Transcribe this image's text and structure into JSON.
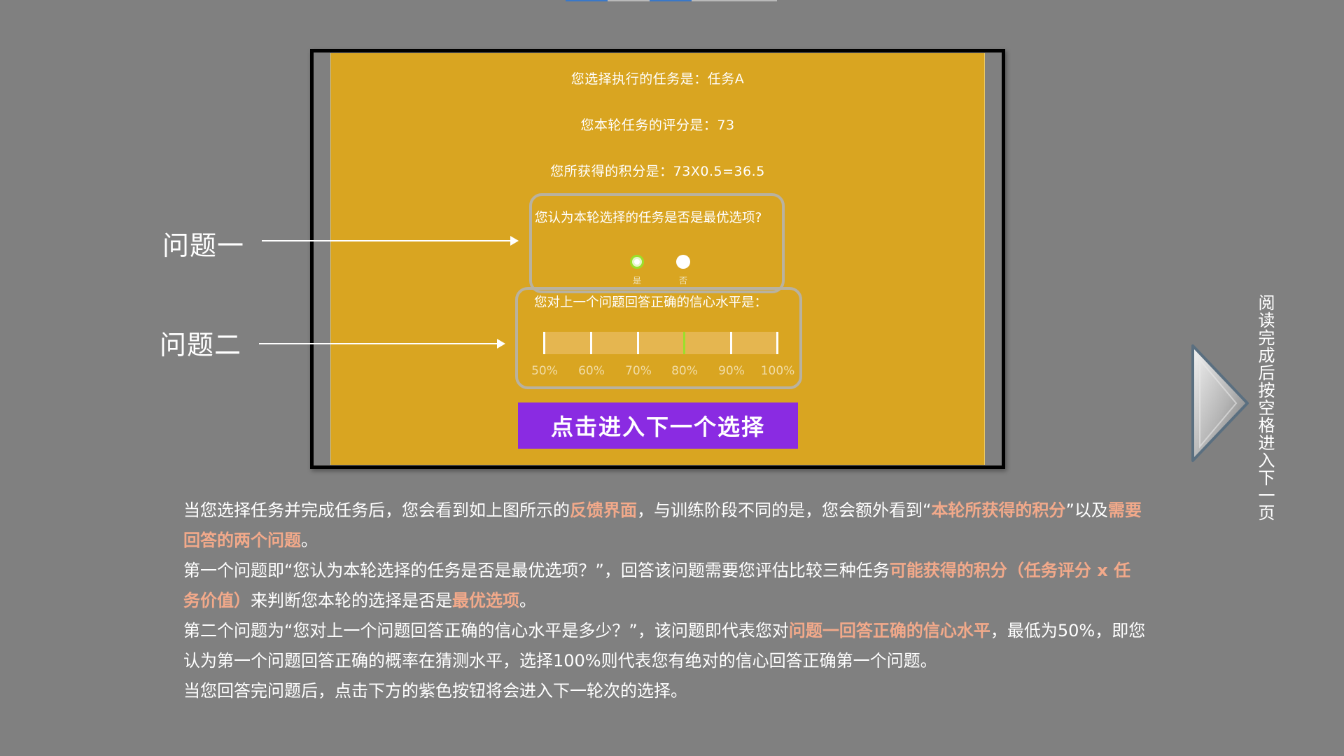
{
  "screenshot": {
    "task_line": "您选择执行的任务是：任务A",
    "score_line": "您本轮任务的评分是：73",
    "points_line": "您所获得的积分是：73X0.5=36.5",
    "question1": {
      "text": "您认为本轮选择的任务是否是最优选项?",
      "options": [
        "是",
        "否"
      ],
      "selected": "是"
    },
    "question2": {
      "text": "您对上一个问题回答正确的信心水平是：",
      "ticks": [
        "50%",
        "60%",
        "70%",
        "80%",
        "90%",
        "100%"
      ],
      "selected": "80%"
    },
    "next_button": "点击进入下一个选择"
  },
  "callouts": {
    "q1": "问题一",
    "q2": "问题二"
  },
  "description": {
    "p1": {
      "t1": "当您选择任务并完成任务后，您会看到如上图所示的",
      "h1": "反馈界面",
      "t2": "，与训练阶段不同的是，您会额外看到“",
      "h2": "本轮所获得的积分",
      "t3": "”以及",
      "h3": "需要回答的两个问题",
      "t4": "。"
    },
    "p2": {
      "t1": "第一个问题即“您认为本轮选择的任务是否是最优选项？”，回答该问题需要您评估比较三种任务",
      "h1": "可能获得的积分（任务评分 x 任务价值）",
      "t2": "来判断您本轮的选择是否是",
      "h2": "最优选项",
      "t3": "。"
    },
    "p3": {
      "t1": "第二个问题为“您对上一个问题回答正确的信心水平是多少？”，该问题即代表您对",
      "h1": "问题一回答正确的信心水平",
      "t2": "，最低为50%，即您认为第一个问题回答正确的概率在猜测水平，选择100%则代表您有绝对的信心回答正确第一个问题。"
    },
    "p4": "当您回答完问题后，点击下方的紫色按钮将会进入下一轮次的选择。"
  },
  "side_note": "阅读完成后按空格进入下一页",
  "colors": {
    "background": "#808080",
    "panel": "#d9a521",
    "button": "#8a2be2",
    "highlight": "#f2a98a",
    "selected": "#9be02a"
  },
  "icons": {
    "next_page": "triangle-right-icon"
  }
}
